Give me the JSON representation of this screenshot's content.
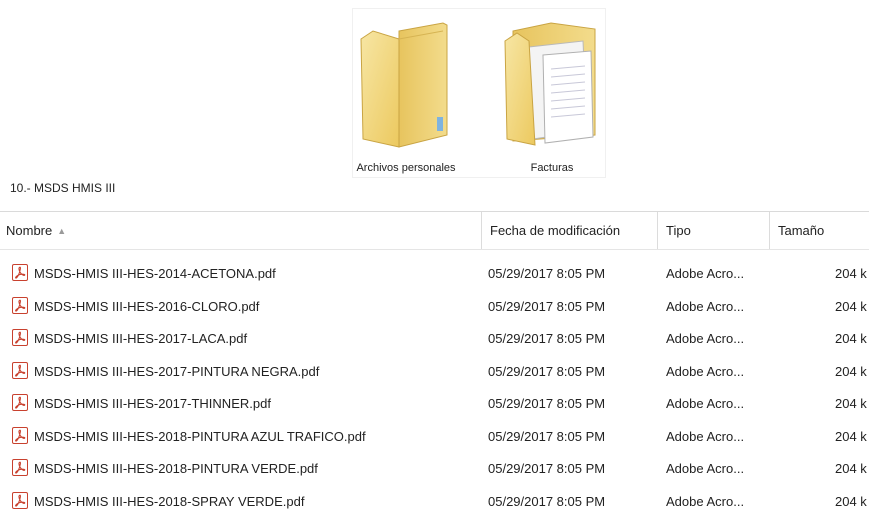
{
  "folders": [
    {
      "label": "Archivos personales",
      "icon": "folder-icon"
    },
    {
      "label": "Facturas",
      "icon": "folder-with-documents-icon"
    }
  ],
  "path_title": "10.- MSDS HMIS III",
  "columns": {
    "name": "Nombre",
    "sort_indicator": "▲",
    "date": "Fecha de modificación",
    "type": "Tipo",
    "size": "Tamaño"
  },
  "files": [
    {
      "name": "MSDS-HMIS III-HES-2014-ACETONA.pdf",
      "date": "05/29/2017 8:05 PM",
      "type": "Adobe Acro...",
      "size": "204 k"
    },
    {
      "name": "MSDS-HMIS III-HES-2016-CLORO.pdf",
      "date": "05/29/2017 8:05 PM",
      "type": "Adobe Acro...",
      "size": "204 k"
    },
    {
      "name": "MSDS-HMIS III-HES-2017-LACA.pdf",
      "date": "05/29/2017 8:05 PM",
      "type": "Adobe Acro...",
      "size": "204 k"
    },
    {
      "name": "MSDS-HMIS III-HES-2017-PINTURA NEGRA.pdf",
      "date": "05/29/2017 8:05 PM",
      "type": "Adobe Acro...",
      "size": "204 k"
    },
    {
      "name": "MSDS-HMIS III-HES-2017-THINNER.pdf",
      "date": "05/29/2017 8:05 PM",
      "type": "Adobe Acro...",
      "size": "204 k"
    },
    {
      "name": "MSDS-HMIS III-HES-2018-PINTURA AZUL TRAFICO.pdf",
      "date": "05/29/2017 8:05 PM",
      "type": "Adobe Acro...",
      "size": "204 k"
    },
    {
      "name": "MSDS-HMIS III-HES-2018-PINTURA VERDE.pdf",
      "date": "05/29/2017 8:05 PM",
      "type": "Adobe Acro...",
      "size": "204 k"
    },
    {
      "name": "MSDS-HMIS III-HES-2018-SPRAY VERDE.pdf",
      "date": "05/29/2017 8:05 PM",
      "type": "Adobe Acro...",
      "size": "204 k"
    }
  ],
  "file_icon": "pdf-icon",
  "colors": {
    "pdf_red": "#c8412e",
    "folder_yellow": "#f2d67a",
    "header_border": "#dcdcdc"
  }
}
